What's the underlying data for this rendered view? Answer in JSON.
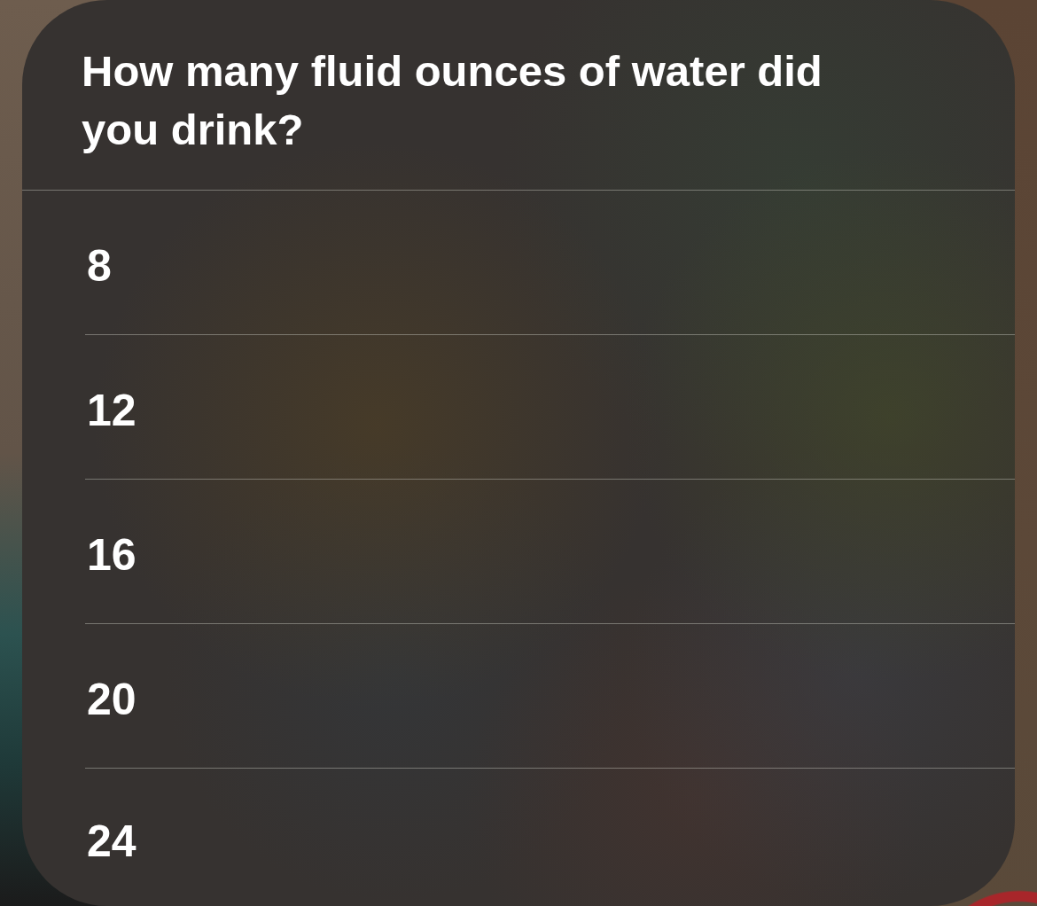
{
  "question": "How many fluid ounces of water did you drink?",
  "options": [
    {
      "label": "8"
    },
    {
      "label": "12"
    },
    {
      "label": "16"
    },
    {
      "label": "20"
    },
    {
      "label": "24"
    }
  ]
}
